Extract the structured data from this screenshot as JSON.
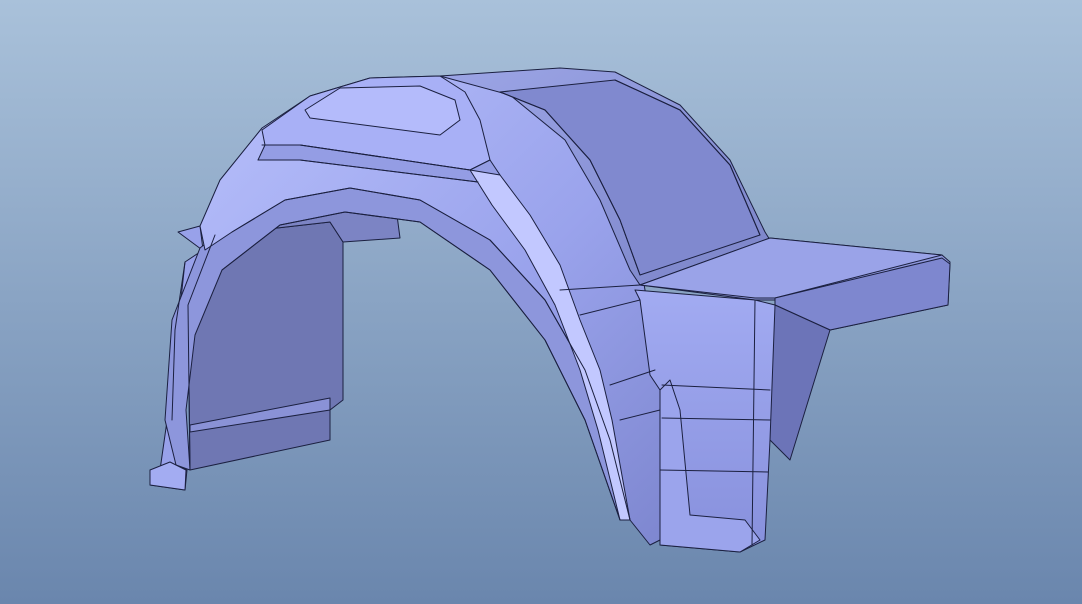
{
  "viewport": {
    "background_top": "#a9c1da",
    "background_bottom": "#6a86ad"
  },
  "model": {
    "part": "fender",
    "shade_light": "#aab2f5",
    "shade_mid": "#8e97de",
    "shade_dark": "#6c74b8",
    "shade_inner": "#6f77b3",
    "edge_color": "#1b2040"
  }
}
